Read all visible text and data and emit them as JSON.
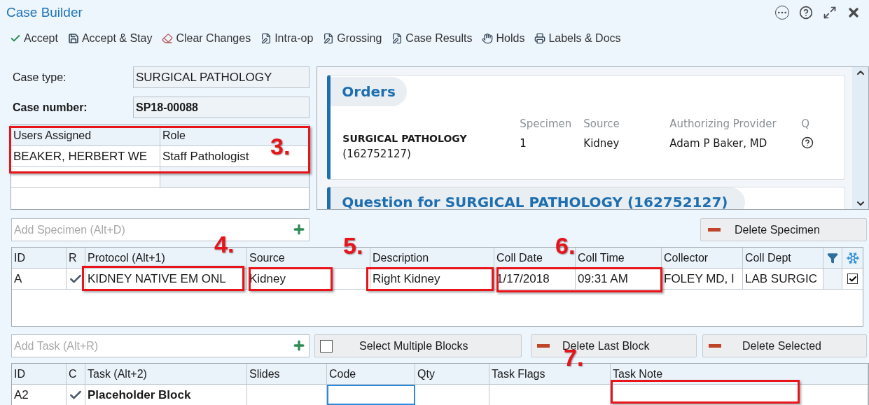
{
  "window": {
    "title": "Case Builder"
  },
  "toolbar": [
    {
      "label": "Accept",
      "kind": "check"
    },
    {
      "label": "Accept & Stay",
      "kind": "save"
    },
    {
      "label": "Clear Changes",
      "kind": "eraser"
    },
    {
      "label": "Intra-op",
      "kind": "doc"
    },
    {
      "label": "Grossing",
      "kind": "doc"
    },
    {
      "label": "Case Results",
      "kind": "doc"
    },
    {
      "label": "Holds",
      "kind": "hand"
    },
    {
      "label": "Labels & Docs",
      "kind": "printer"
    }
  ],
  "case": {
    "type_label": "Case type:",
    "type_value": "SURGICAL PATHOLOGY",
    "number_label": "Case number:",
    "number_value": "SP18-00088"
  },
  "users_table": {
    "columns": [
      "Users Assigned",
      "Role"
    ],
    "rows": [
      [
        "BEAKER, HERBERT WE",
        "Staff Pathologist"
      ]
    ]
  },
  "orders": {
    "title": "Orders",
    "columns": [
      "Specimen",
      "Source",
      "Authorizing Provider",
      "Q"
    ],
    "order": {
      "name": "SURGICAL PATHOLOGY",
      "number": "(162752127)",
      "specimen": "1",
      "source": "Kidney",
      "provider": "Adam P Baker, MD"
    },
    "next_section": "Question for SURGICAL PATHOLOGY (162752127)"
  },
  "add_specimen": {
    "placeholder": "Add Specimen (Alt+D)"
  },
  "delete_specimen": "Delete Specimen",
  "specimen_table": {
    "columns": [
      "ID",
      "R",
      "Protocol (Alt+1)",
      "Source",
      "Description",
      "Coll Date",
      "Coll Time",
      "Collector",
      "Coll Dept"
    ],
    "rows": [
      {
        "cells": [
          "A",
          "",
          "KIDNEY NATIVE EM ONL",
          "Kidney",
          "Right Kidney",
          "1/17/2018",
          "09:31 AM",
          "FOLEY MD, I",
          "LAB SURGIC"
        ],
        "received": true,
        "checked": true
      }
    ]
  },
  "add_task": {
    "placeholder": "Add Task (Alt+R)"
  },
  "task_buttons": {
    "select_multiple": {
      "label": "Select Multiple Blocks",
      "checked": false
    },
    "delete_last": "Delete Last Block",
    "delete_selected": "Delete Selected"
  },
  "task_table": {
    "columns": [
      "ID",
      "C",
      "Task (Alt+2)",
      "Slides",
      "Code",
      "Qty",
      "Task Flags",
      "Task Note"
    ],
    "rows": [
      {
        "cells": [
          "A2",
          "",
          "Placeholder Block",
          "",
          "",
          "",
          "",
          ""
        ],
        "complete": true
      }
    ]
  },
  "annotations": [
    {
      "label": "3."
    },
    {
      "label": "4."
    },
    {
      "label": "5."
    },
    {
      "label": "6."
    },
    {
      "label": "7."
    }
  ]
}
